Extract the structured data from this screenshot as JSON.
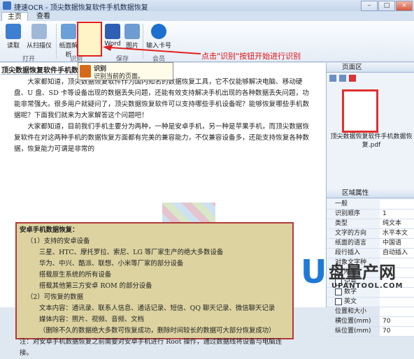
{
  "window": {
    "title": "捷速OCR - 顶尖数据恢复软件手机数据恢复",
    "buttons": [
      "–",
      "□",
      "×"
    ]
  },
  "tabs": [
    "主页",
    "查看"
  ],
  "ribbon": {
    "buttons": [
      "读取",
      "从扫描仪",
      "纸面解析",
      "识别",
      "Word",
      "图片",
      "输入卡号"
    ],
    "groups": [
      "打开",
      "识别",
      "保存",
      "会员"
    ]
  },
  "callout": "点击\"识别\"按钮开始进行识别",
  "tooltip": {
    "title": "识别",
    "desc": "识别当前的页面。"
  },
  "document": {
    "tab_title": "顶尖数据恢复软件手机数",
    "paragraphs": [
      "大家都知道，顶尖数据恢复软件作为国内知名的数据恢复工具，它不仅能够解决电脑、移动硬盘、U 盘、SD 卡等设备出现的数据丢失问题，还能有效支持解决手机出现的各种数据丢失问题，功能非常强大。很多用户就疑问了，顶尖数据恢复软件可以支持哪些手机设备呢？能够恢复哪些手机数据呢？下面我们就来为大家解答这个问题吧！",
      "大家都知道，目前我们手机主要分为两种，一种是安卓手机，另一种是苹果手机，而顶尖数据恢复软件在对这两种手机的数据恢复方面都有完美的兼容能力，不仅兼容设备多，还能支持恢复各种数据，恢复能力可谓是非常的"
    ],
    "section": {
      "heading": "安卓手机数据恢复：",
      "lines": [
        {
          "indent": 1,
          "text": "（1）支持的安卓设备"
        },
        {
          "indent": 2,
          "text": "三星、HTC、摩托罗拉、索尼、LG 等厂家生产的绝大多数设备"
        },
        {
          "indent": 2,
          "text": "华为、中兴、酷派、联想、小米等厂家的部分设备"
        },
        {
          "indent": 2,
          "text": "搭载原生系统的所有设备"
        },
        {
          "indent": 2,
          "text": "搭载其他第三方安卓 ROM 的部分设备"
        },
        {
          "indent": 1,
          "text": "（2）可恢复的数据"
        },
        {
          "indent": 2,
          "text": "文本内容：通讯录、联系人信息、通话记录、短信、QQ 聊天记录、微信聊天记录"
        },
        {
          "indent": 2,
          "text": "媒体内容：照片、视频、音频、文档"
        },
        {
          "indent": 2,
          "text": "（删除不久的数据绝大多数可恢复成功，删除时间较长的数据可大部分恢复成功）"
        },
        {
          "indent": 0,
          "text": "注：对安卓手机数据恢复之前需要对安卓手机进行 Root 操作，通过数据线将设备与电脑连接。"
        }
      ]
    }
  },
  "page_panel": {
    "title": "页面区",
    "thumb_label": "顶尖数据恢复软件手机数据恢复.pdf"
  },
  "props_panel": {
    "title": "区域属性",
    "rows": [
      {
        "key": "一般",
        "value": ""
      },
      {
        "key": "识别顺序",
        "value": "1"
      },
      {
        "key": "类型",
        "value": "纯文本"
      },
      {
        "key": "文字的方向",
        "value": "水平本文"
      },
      {
        "key": "纸面的语言",
        "value": "中国语"
      },
      {
        "key": "段行插入",
        "value": "自动插入"
      },
      {
        "key": "对象文字种",
        "value": ""
      },
      {
        "key": "所有",
        "value": ""
      },
      {
        "key": "记号",
        "value": ""
      },
      {
        "key": "数字",
        "value": ""
      },
      {
        "key": "英文",
        "value": ""
      },
      {
        "key": "位置和大小",
        "value": ""
      },
      {
        "key": "横位置(mm)",
        "value": "70"
      },
      {
        "key": "纵位置(mm)",
        "value": "70"
      }
    ]
  },
  "watermark": {
    "u": "U",
    "cn": "盘量产网",
    "url": "UPANTOOL.COM"
  },
  "colors": {
    "accent": "#e02020",
    "selection_fill": "#dcd3a0",
    "ribbon_bg": "#e4ecf6"
  }
}
